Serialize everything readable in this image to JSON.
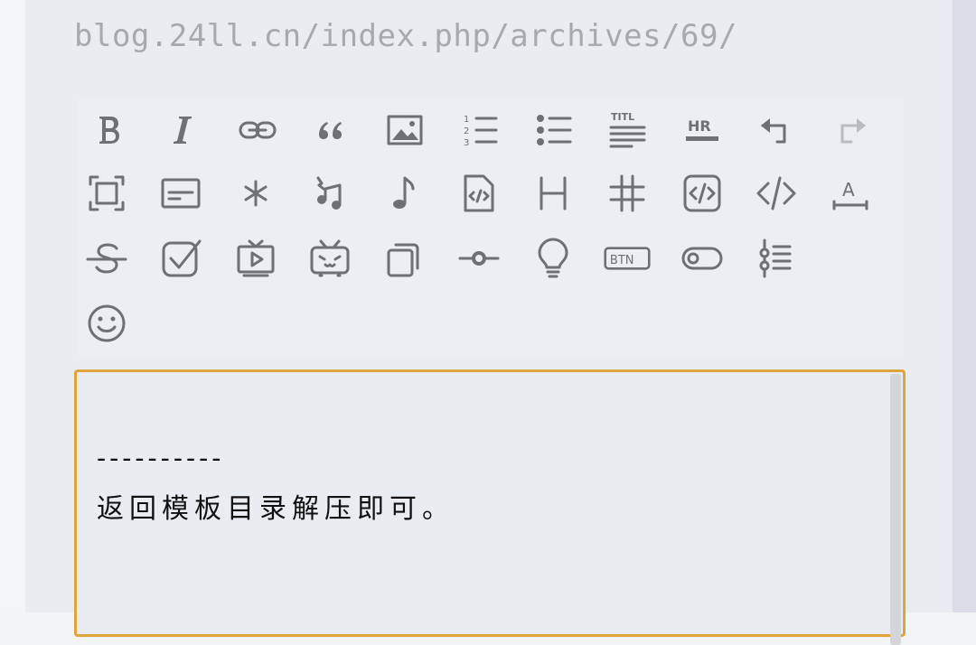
{
  "page": {
    "permalink": "blog.24ll.cn/index.php/archives/69/"
  },
  "toolbar": {
    "icons": [
      "bold-icon",
      "italic-icon",
      "link-icon",
      "quote-icon",
      "image-icon",
      "ordered-list-icon",
      "unordered-list-icon",
      "title-icon",
      "horizontal-rule-icon",
      "undo-icon",
      "redo-icon",
      "fullscreen-icon",
      "card-icon",
      "asterisk-icon",
      "music-list-icon",
      "music-note-icon",
      "code-file-icon",
      "heading-icon",
      "hash-icon",
      "code-block-icon",
      "inline-code-icon",
      "text-underline-icon",
      "strikethrough-icon",
      "checkbox-icon",
      "video-icon",
      "bilibili-icon",
      "copy-icon",
      "slider-icon",
      "lightbulb-icon",
      "btn-icon",
      "toggle-icon",
      "timeline-icon",
      "emoji-icon"
    ],
    "btn_text": "BTN",
    "hr_text": "HR",
    "title_text": "TITL",
    "ordered_nums": [
      "1",
      "2",
      "3"
    ],
    "colors": {
      "icon": "#6d7074",
      "disabled": "#b8bbbf"
    }
  },
  "editor": {
    "line1": "----------",
    "line2": "返回模板目录解压即可。",
    "border_color": "#e0a53a"
  }
}
